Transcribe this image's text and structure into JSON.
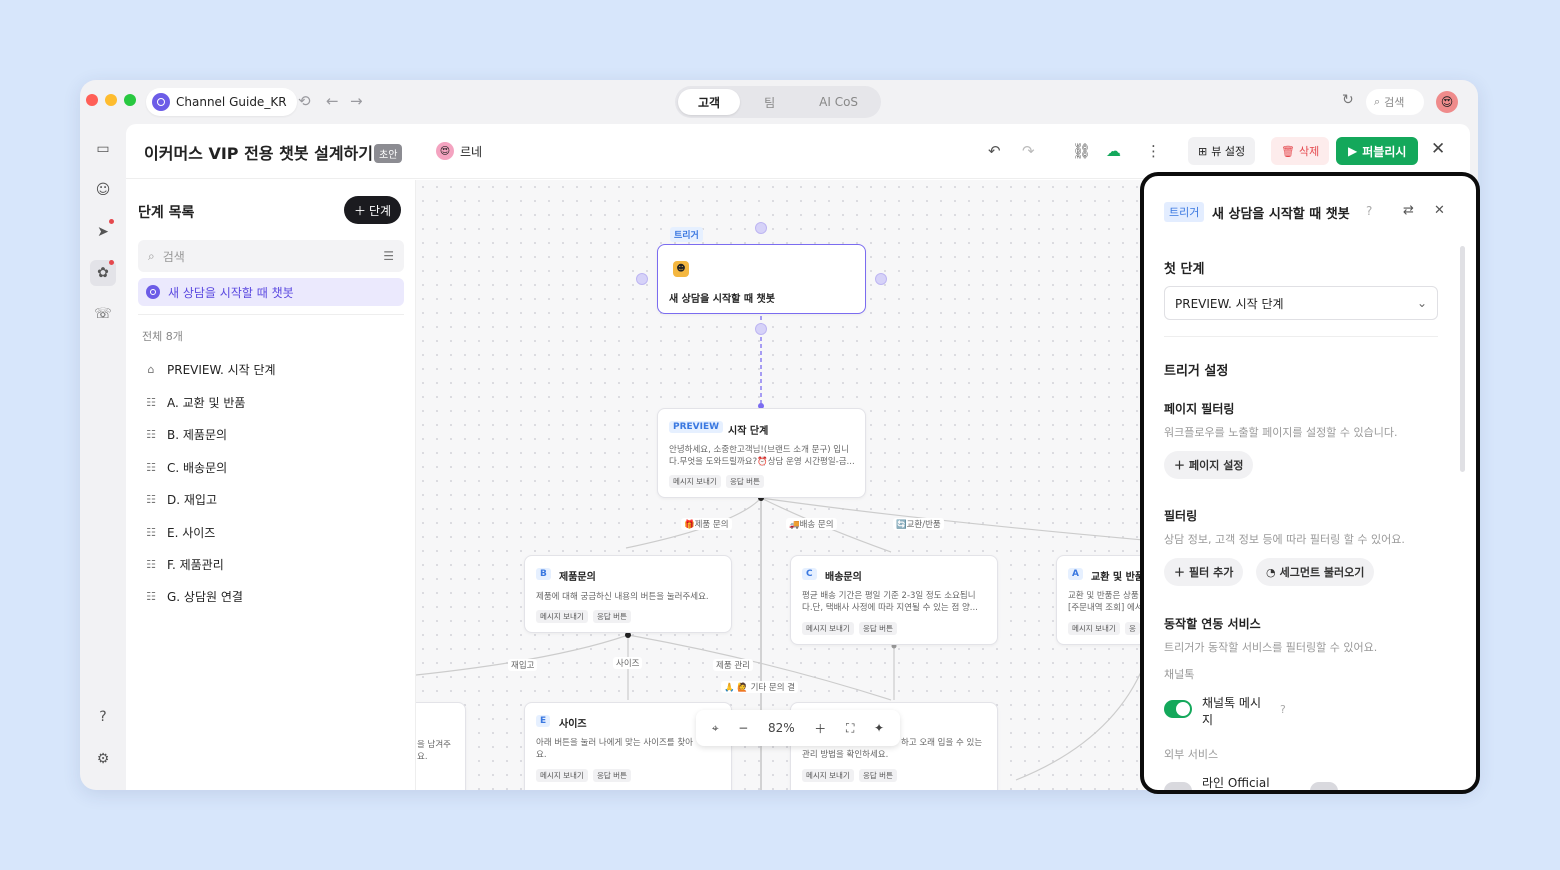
{
  "window": {
    "workspace": "Channel Guide_KR",
    "tabs": [
      {
        "label": "고객"
      },
      {
        "label": "팀"
      },
      {
        "label": "AI CoS"
      }
    ],
    "search_label": "검색",
    "lights": [
      "#ff5f57",
      "#febc2e",
      "#28c840"
    ]
  },
  "header": {
    "title": "이커머스 VIP 전용 챗봇 설계하기",
    "status": "초안",
    "owner": "르네",
    "view_settings": "뷰 설정",
    "delete": "삭제",
    "publish": "퍼블리시"
  },
  "sidebar": {
    "title": "단계 목록",
    "add_step": "단계",
    "search_placeholder": "검색",
    "selected_trigger": "새 상담을 시작할 때 챗봇",
    "count_label": "전체 8개",
    "steps": [
      {
        "label": "PREVIEW. 시작 단계"
      },
      {
        "label": "A. 교환 및 반품"
      },
      {
        "label": "B. 제품문의"
      },
      {
        "label": "C. 배송문의"
      },
      {
        "label": "D. 재입고"
      },
      {
        "label": "E. 사이즈"
      },
      {
        "label": "F. 제품관리"
      },
      {
        "label": "G. 상담원 연결"
      }
    ]
  },
  "canvas": {
    "trigger_node": {
      "tag": "트리거",
      "title": "새 상담을 시작할 때 챗봇"
    },
    "preview_node": {
      "tag": "PREVIEW",
      "title": "시작 단계",
      "desc1": "안녕하세요, 소중한고객님!(브랜드 소개 문구) 입니",
      "desc2": "다.무엇을 도와드릴까요?⏰상담 운영 시간평일-금...",
      "chip1": "메시지 보내기",
      "chip2": "응답 버튼"
    },
    "edge_labels": {
      "product": "🎁제품 문의",
      "delivery": "🚚배송 문의",
      "exchange": "🔄교환/반품",
      "restock": "재입고",
      "size": "사이즈",
      "care": "제품 관리",
      "etc": "🙏 🙋 기타 문의 결"
    },
    "node_b": {
      "tag": "B",
      "title": "제품문의",
      "desc1": "제품에 대해 궁금하신 내용의 버튼을 눌러주세요.",
      "chip1": "메시지 보내기",
      "chip2": "응답 버튼"
    },
    "node_c": {
      "tag": "C",
      "title": "배송문의",
      "desc1": "평균 배송 기간은 평일 기준 2-3일 정도 소요됩니",
      "desc2": "다.단, 택배사 사정에 따라 지연될 수 있는 점 양...",
      "chip1": "메시지 보내기",
      "chip2": "응답 버튼"
    },
    "node_a": {
      "tag": "A",
      "title": "교환 및 반품",
      "desc1": "교환 및 반품은 상품",
      "desc2": "[주문내역 조회] 에서",
      "chip1": "메시지 보내기",
      "chip2": "응"
    },
    "node_e": {
      "tag": "E",
      "title": "사이즈",
      "desc1": "아래 버튼을 눌러 나에게 맞는 사이즈를 찾아",
      "desc2": "요.",
      "chip1": "메시지 보내기",
      "chip2": "응답 버튼"
    },
    "node_f": {
      "desc1": "하고 오래 입을 수 있는",
      "desc2": "관리 방법을 확인하세요.",
      "chip1": "메시지 보내기",
      "chip2": "응답 버튼"
    },
    "node_left": {
      "desc1": "을 남겨주",
      "desc2": "요."
    },
    "zoom": "82%"
  },
  "panel": {
    "tag": "트리거",
    "title": "새 상담을 시작할 때 챗봇",
    "first_step_label": "첫 단계",
    "first_step_value": "PREVIEW. 시작 단계",
    "trigger_settings": "트리거 설정",
    "page_filter": {
      "title": "페이지 필터링",
      "desc": "워크플로우를 노출할 페이지를 설정할 수 있습니다.",
      "button": "페이지 설정"
    },
    "filter": {
      "title": "필터링",
      "desc": "상담 정보, 고객 정보 등에 따라 필터링 할 수 있어요.",
      "add": "필터 추가",
      "segment": "세그먼트 불러오기"
    },
    "services": {
      "title": "동작할 연동 서비스",
      "desc": "트리거가 동작할 서비스를 필터링할 수 있어요.",
      "channeltalk": "채널톡",
      "channel_msg_1": "채널톡 메시",
      "channel_msg_2": "지",
      "external": "외부 서비스",
      "line": "라인 Official"
    }
  },
  "colors": {
    "accent": "#7b6cf0",
    "publish": "#14a85b",
    "danger": "#e5484d"
  }
}
